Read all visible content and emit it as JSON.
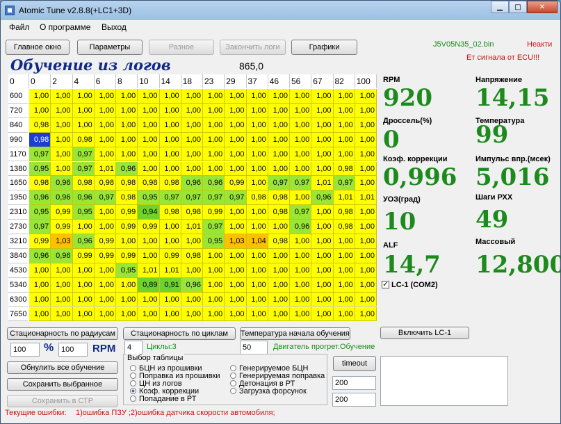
{
  "window": {
    "title": "Atomic Tune  v2.8.8(+LC1+3D)",
    "min": "▁",
    "max": "□",
    "close": "✕"
  },
  "menu": [
    "Файл",
    "О программе",
    "Выход"
  ],
  "toolbar": {
    "main": "Главное окно",
    "params": "Параметры",
    "misc": "Разное",
    "stop_logs": "Закончить логи",
    "graphs": "Графики"
  },
  "status": {
    "file": "J5V05N35_02.bin",
    "inactive": "Неакти",
    "no_signal": "Ет сигнала от ECU!!!"
  },
  "heading": "Обучение из логов",
  "cell_value": "865,0",
  "table": {
    "corner": "0",
    "columns": [
      "0",
      "2",
      "4",
      "6",
      "8",
      "10",
      "14",
      "18",
      "23",
      "29",
      "37",
      "46",
      "56",
      "67",
      "82",
      "100"
    ],
    "rows": [
      "600",
      "720",
      "840",
      "990",
      "1170",
      "1380",
      "1650",
      "1950",
      "2310",
      "2730",
      "3210",
      "3840",
      "4530",
      "5340",
      "6300",
      "7650"
    ],
    "cells": [
      [
        "1,00",
        "1,00",
        "1,00",
        "1,00",
        "1,00",
        "1,00",
        "1,00",
        "1,00",
        "1,00",
        "1,00",
        "1,00",
        "1,00",
        "1,00",
        "1,00",
        "1,00",
        "1,00"
      ],
      [
        "1,00",
        "1,00",
        "1,00",
        "1,00",
        "1,00",
        "1,00",
        "1,00",
        "1,00",
        "1,00",
        "1,00",
        "1,00",
        "1,00",
        "1,00",
        "1,00",
        "1,00",
        "1,00"
      ],
      [
        "0,98",
        "1,00",
        "1,00",
        "1,00",
        "1,00",
        "1,00",
        "1,00",
        "1,00",
        "1,00",
        "1,00",
        "1,00",
        "1,00",
        "1,00",
        "1,00",
        "1,00",
        "1,00"
      ],
      [
        "0,98",
        "1,00",
        "0,98",
        "1,00",
        "1,00",
        "1,00",
        "1,00",
        "1,00",
        "1,00",
        "1,00",
        "1,00",
        "1,00",
        "1,00",
        "1,00",
        "1,00",
        "1,00"
      ],
      [
        "0,97",
        "1,00",
        "0,97",
        "1,00",
        "1,00",
        "1,00",
        "1,00",
        "1,00",
        "1,00",
        "1,00",
        "1,00",
        "1,00",
        "1,00",
        "1,00",
        "1,00",
        "1,00"
      ],
      [
        "0,95",
        "1,00",
        "0,97",
        "1,01",
        "0,96",
        "1,00",
        "1,00",
        "1,00",
        "1,00",
        "1,00",
        "1,00",
        "1,00",
        "1,00",
        "1,00",
        "0,98",
        "1,00"
      ],
      [
        "0,98",
        "0,96",
        "0,98",
        "0,98",
        "0,98",
        "0,98",
        "0,98",
        "0,96",
        "0,96",
        "0,99",
        "1,00",
        "0,97",
        "0,97",
        "1,01",
        "0,97",
        "1,00"
      ],
      [
        "0,96",
        "0,96",
        "0,96",
        "0,97",
        "0,98",
        "0,95",
        "0,97",
        "0,97",
        "0,97",
        "0,97",
        "0,98",
        "0,98",
        "1,00",
        "0,96",
        "1,01",
        "1,01"
      ],
      [
        "0,95",
        "0,99",
        "0,95",
        "1,00",
        "0,99",
        "0,94",
        "0,98",
        "0,98",
        "0,99",
        "1,00",
        "1,00",
        "0,98",
        "0,97",
        "1,00",
        "0,98",
        "1,00"
      ],
      [
        "0,97",
        "0,99",
        "1,00",
        "1,00",
        "0,99",
        "0,99",
        "1,00",
        "1,01",
        "0,97",
        "1,00",
        "1,00",
        "1,00",
        "0,96",
        "1,00",
        "0,98",
        "1,00"
      ],
      [
        "0,99",
        "1,03",
        "0,96",
        "0,99",
        "1,00",
        "1,00",
        "1,00",
        "1,00",
        "0,95",
        "1,03",
        "1,04",
        "0,98",
        "1,00",
        "1,00",
        "1,00",
        "1,00"
      ],
      [
        "0,96",
        "0,96",
        "0,99",
        "0,99",
        "0,99",
        "1,00",
        "0,99",
        "0,98",
        "1,00",
        "1,00",
        "1,00",
        "1,00",
        "1,00",
        "1,00",
        "1,00",
        "1,00"
      ],
      [
        "1,00",
        "1,00",
        "1,00",
        "1,00",
        "0,95",
        "1,01",
        "1,01",
        "1,00",
        "1,00",
        "1,00",
        "1,00",
        "1,00",
        "1,00",
        "1,00",
        "1,00",
        "1,00"
      ],
      [
        "1,00",
        "1,00",
        "1,00",
        "1,00",
        "1,00",
        "0,89",
        "0,91",
        "0,96",
        "1,00",
        "1,00",
        "1,00",
        "1,00",
        "1,00",
        "1,00",
        "1,00",
        "1,00"
      ],
      [
        "1,00",
        "1,00",
        "1,00",
        "1,00",
        "1,00",
        "1,00",
        "1,00",
        "1,00",
        "1,00",
        "1,00",
        "1,00",
        "1,00",
        "1,00",
        "1,00",
        "1,00",
        "1,00"
      ],
      [
        "1,00",
        "1,00",
        "1,00",
        "1,00",
        "1,00",
        "1,00",
        "1,00",
        "1,00",
        "1,00",
        "1,00",
        "1,00",
        "1,00",
        "1,00",
        "1,00",
        "1,00",
        "1,00"
      ]
    ],
    "selected": {
      "row": 3,
      "col": 0
    }
  },
  "colors": {
    "cell_yellow": "#ffff00",
    "cell_green": "#9ae636",
    "cell_green_dark": "#6fd42a",
    "cell_orange": "#ffc000",
    "cell_selected": "#1a3fd6",
    "accent_green": "#1d8a1d"
  },
  "readouts": {
    "rpm": {
      "label": "RPM",
      "value": "920"
    },
    "voltage": {
      "label": "Напряжение",
      "value": "14,15"
    },
    "throttle": {
      "label": "Дроссель(%)",
      "value": "0"
    },
    "temperature": {
      "label": "Температура",
      "value": "99"
    },
    "correction": {
      "label": "Коэф. коррекции",
      "value": "0,996"
    },
    "injection": {
      "label": "Импульс впр.(мсек)",
      "value": "5,016"
    },
    "timing": {
      "label": "УОЗ(град)",
      "value": "10"
    },
    "idle_steps": {
      "label": "Шаги РХХ",
      "value": "49"
    },
    "alf": {
      "label": "ALF",
      "value": "14,7"
    },
    "mass": {
      "label": "Массовый",
      "value": "12,800"
    }
  },
  "lc1": {
    "label": "LC-1 (COM2)",
    "checked": true
  },
  "bottom": {
    "btn_radius": "Стационарность по радиусам",
    "btn_cycles": "Стационарность по циклам",
    "btn_temp": "Температура начала обучения",
    "btn_lc1": "Включить LC-1",
    "pct_value": "100",
    "pct_sign": "%",
    "rpm_value": "100",
    "rpm_label": "RPM",
    "cycles_value": "4",
    "cycles_label": "Циклы:3",
    "temp_value": "50",
    "temp_status": "Двигатель прогрет.Обучение",
    "btn_reset": "Обнулить все обучение",
    "btn_save_sel": "Сохранить выбранное",
    "btn_save_ctp": "Сохранить в СТР",
    "btn_timeout": "timeout",
    "timeout_a": "200",
    "timeout_b": "200",
    "table_select": {
      "title": "Выбор таблицы",
      "options": [
        "БЦН из прошивки",
        "Поправка из прошивки",
        "ЦН из логов",
        "Коэф. коррекции",
        "Попадание в РТ",
        "Генерируемое БЦН",
        "Генерируемая поправка",
        "Детонация в РТ",
        "Загрузка форсунок"
      ],
      "selected": 3
    }
  },
  "errors": {
    "label": "Текущие ошибки:",
    "text": "1)ошибка ПЗУ ;2)ошибка датчика скорости автомобиля;"
  }
}
